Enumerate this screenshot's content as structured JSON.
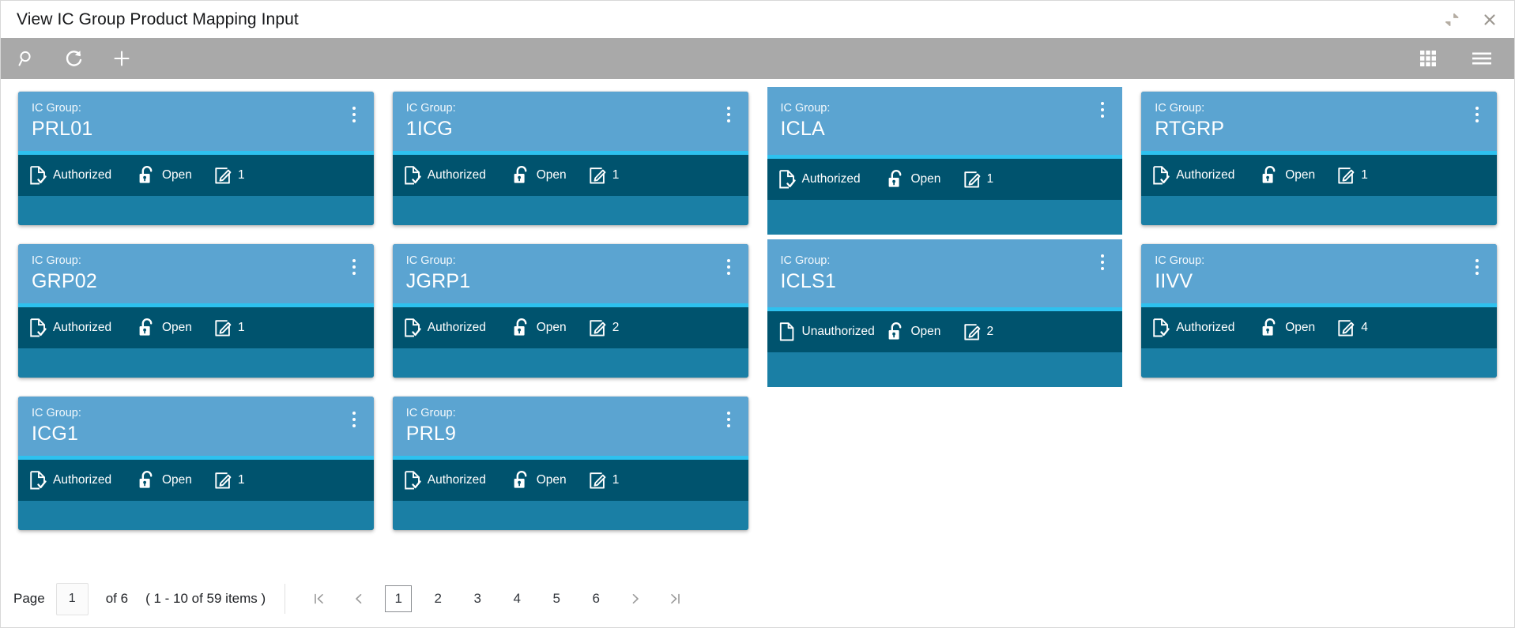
{
  "window": {
    "title": "View IC Group Product Mapping Input",
    "restore_icon": "restore-down-icon",
    "close_icon": "close-icon"
  },
  "toolbar": {
    "search_label": "Search",
    "refresh_label": "Refresh",
    "add_label": "Add",
    "tile_view_label": "Tile View",
    "menu_label": "Menu",
    "search_icon": "search-icon",
    "refresh_icon": "refresh-icon",
    "add_icon": "plus-icon",
    "tile_view_icon": "grid-icon",
    "menu_icon": "hamburger-menu-icon"
  },
  "card_meta": {
    "field_label": "IC Group:",
    "auth_icon": "document-check-icon",
    "unauth_icon": "document-icon",
    "lock_icon": "unlocked-padlock-icon",
    "count_icon": "edit-square-icon",
    "menu_icon": "kebab-menu-icon",
    "colors": {
      "header": "#5ba4d1",
      "divider": "#2ec1ef",
      "status": "#00536e",
      "footer": "#1a7fa5",
      "toolbar": "#a9a9a9"
    }
  },
  "cards": [
    {
      "value": "PRL01",
      "auth": "Authorized",
      "authorized": true,
      "lock": "Open",
      "count": "1",
      "flush": false
    },
    {
      "value": "1ICG",
      "auth": "Authorized",
      "authorized": true,
      "lock": "Open",
      "count": "1",
      "flush": false
    },
    {
      "value": "ICLA",
      "auth": "Authorized",
      "authorized": true,
      "lock": "Open",
      "count": "1",
      "flush": true
    },
    {
      "value": "RTGRP",
      "auth": "Authorized",
      "authorized": true,
      "lock": "Open",
      "count": "1",
      "flush": false
    },
    {
      "value": "GRP02",
      "auth": "Authorized",
      "authorized": true,
      "lock": "Open",
      "count": "1",
      "flush": false
    },
    {
      "value": "JGRP1",
      "auth": "Authorized",
      "authorized": true,
      "lock": "Open",
      "count": "2",
      "flush": false
    },
    {
      "value": "ICLS1",
      "auth": "Unauthorized",
      "authorized": false,
      "lock": "Open",
      "count": "2",
      "flush": true
    },
    {
      "value": "IIVV",
      "auth": "Authorized",
      "authorized": true,
      "lock": "Open",
      "count": "4",
      "flush": false
    },
    {
      "value": "ICG1",
      "auth": "Authorized",
      "authorized": true,
      "lock": "Open",
      "count": "1",
      "flush": false
    },
    {
      "value": "PRL9",
      "auth": "Authorized",
      "authorized": true,
      "lock": "Open",
      "count": "1",
      "flush": false
    }
  ],
  "pagination": {
    "page_label": "Page",
    "page_value": "1",
    "of_text": "of 6",
    "range_text": "( 1 - 10 of 59 items )",
    "first_icon": "first-page-icon",
    "prev_icon": "previous-page-icon",
    "next_icon": "next-page-icon",
    "last_icon": "last-page-icon",
    "pages": [
      "1",
      "2",
      "3",
      "4",
      "5",
      "6"
    ],
    "active_page": "1"
  }
}
